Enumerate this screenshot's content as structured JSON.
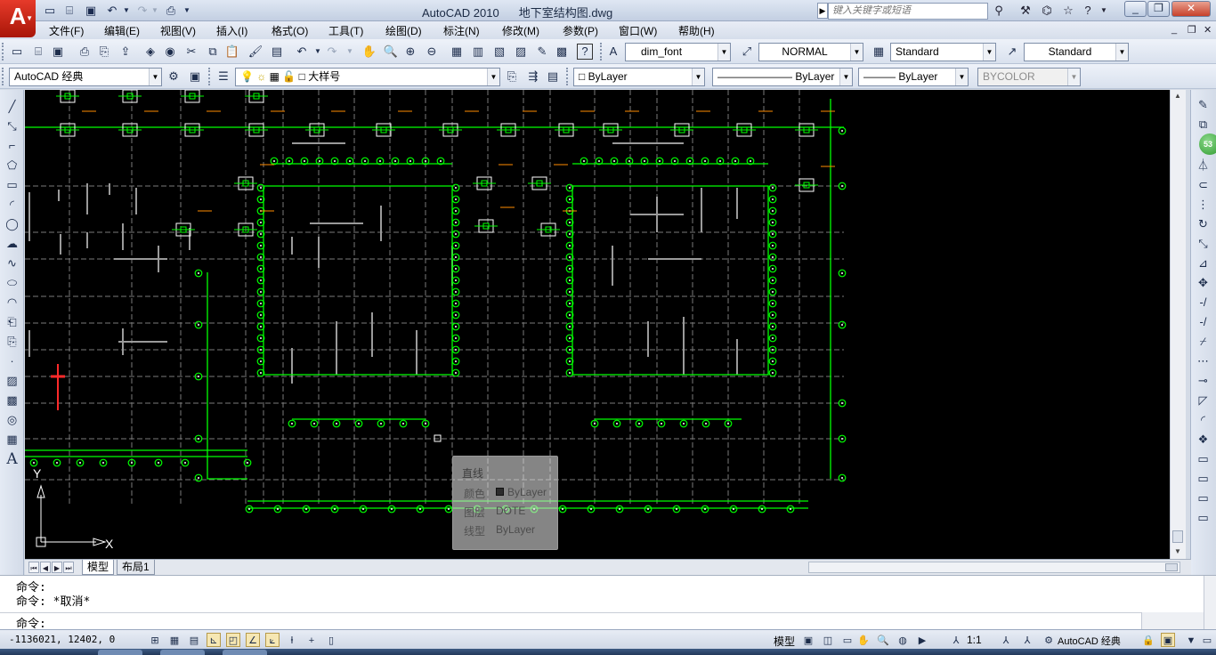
{
  "app": {
    "logo_letter": "A",
    "title": "AutoCAD 2010",
    "filename": "地下室结构图.dwg",
    "help_search_placeholder": "键入关键字或短语"
  },
  "menu": [
    "文件(F)",
    "编辑(E)",
    "视图(V)",
    "插入(I)",
    "格式(O)",
    "工具(T)",
    "绘图(D)",
    "标注(N)",
    "修改(M)",
    "参数(P)",
    "窗口(W)",
    "帮助(H)"
  ],
  "styles_toolbar": {
    "text_style": "dim_font",
    "dim_style": "NORMAL",
    "table_style": "Standard",
    "multileader_style": "Standard"
  },
  "layers_toolbar": {
    "workspace": "AutoCAD 经典",
    "current_layer": "大样号",
    "color": "ByLayer",
    "linetype": "ByLayer",
    "lineweight": "ByLayer",
    "plot_style": "BYCOLOR"
  },
  "right_badge": "53",
  "tooltip": {
    "title": "直线",
    "rows": [
      {
        "key": "颜色",
        "value": "ByLayer"
      },
      {
        "key": "图层",
        "value": "DOTE"
      },
      {
        "key": "线型",
        "value": "ByLayer"
      }
    ]
  },
  "ucs": {
    "x_label": "X",
    "y_label": "Y"
  },
  "layout_tabs": [
    "模型",
    "布局1"
  ],
  "command_history": [
    "命令:",
    "命令: *取消*"
  ],
  "command_prompt": "命令:",
  "status": {
    "coordinates": "-1136021, 12402, 0",
    "model_label": "模型",
    "annotation_scale": "1:1",
    "workspace_label": "AutoCAD 经典"
  },
  "colors": {
    "canvas": "#000000",
    "grid_line": "#00ff00",
    "column": "#ffffff",
    "annotation": "#ff8c00",
    "axis_text": "#ffffff"
  }
}
